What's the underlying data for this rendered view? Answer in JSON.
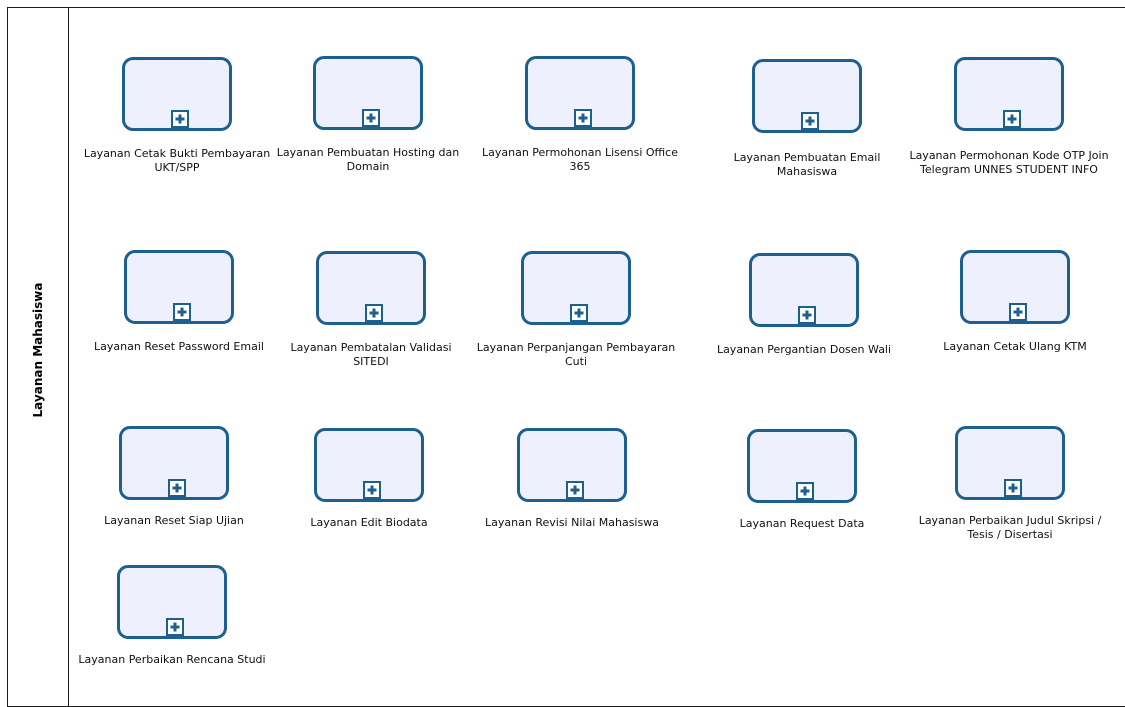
{
  "lane": {
    "title": "Layanan Mahasiswa"
  },
  "tasks": [
    {
      "label": "Layanan Cetak Bukti Pembayaran UKT/SPP"
    },
    {
      "label": "Layanan Pembuatan Hosting dan Domain"
    },
    {
      "label": "Layanan Permohonan Lisensi Office 365"
    },
    {
      "label": "Layanan Pembuatan Email Mahasiswa"
    },
    {
      "label": "Layanan Permohonan Kode OTP Join Telegram UNNES STUDENT INFO"
    },
    {
      "label": "Layanan Reset Password Email"
    },
    {
      "label": "Layanan Pembatalan Validasi SITEDI"
    },
    {
      "label": "Layanan Perpanjangan Pembayaran Cuti"
    },
    {
      "label": "Layanan Pergantian Dosen Wali"
    },
    {
      "label": "Layanan Cetak Ulang KTM"
    },
    {
      "label": "Layanan Reset Siap Ujian"
    },
    {
      "label": "Layanan Edit Biodata"
    },
    {
      "label": "Layanan Revisi Nilai Mahasiswa"
    },
    {
      "label": "Layanan Request Data"
    },
    {
      "label": "Layanan Perbaikan Judul Skripsi / Tesis / Disertasi"
    },
    {
      "label": "Layanan Perbaikan Rencana Studi"
    }
  ],
  "colors": {
    "task_border": "#1d5f8f",
    "task_fill": "#eef0fd",
    "line": "#1a1a1a"
  },
  "icons": {
    "task_marker": "plus-icon"
  }
}
